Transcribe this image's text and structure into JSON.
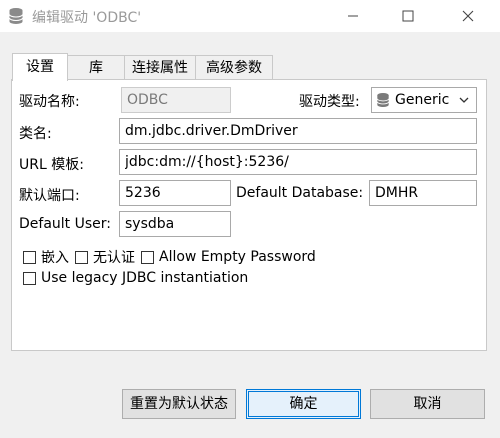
{
  "window": {
    "title": "编辑驱动 'ODBC'",
    "icon": "database-icon",
    "controls": [
      "minimize",
      "maximize",
      "close"
    ]
  },
  "tabs": [
    {
      "label": "设置",
      "active": true
    },
    {
      "label": "库",
      "active": false
    },
    {
      "label": "连接属性",
      "active": false
    },
    {
      "label": "高级参数",
      "active": false
    }
  ],
  "settings": {
    "driver_name_label": "驱动名称:",
    "driver_name_value": "ODBC",
    "driver_type_label": "驱动类型:",
    "driver_type_value": "Generic",
    "class_name_label": "类名:",
    "class_name_value": "dm.jdbc.driver.DmDriver",
    "url_label": "URL 模板:",
    "url_value": "jdbc:dm://{host}:5236/",
    "port_label": "默认端口:",
    "port_value": "5236",
    "db_label": "Default Database:",
    "db_value": "DMHR",
    "user_label": "Default User:",
    "user_value": "sysdba"
  },
  "options": {
    "embedded_label": "嵌入",
    "no_auth_label": "无认证",
    "allow_empty_label": "Allow Empty Password",
    "legacy_label": "Use legacy JDBC instantiation"
  },
  "buttons": {
    "reset": "重置为默认状态",
    "ok": "确定",
    "cancel": "取消"
  }
}
